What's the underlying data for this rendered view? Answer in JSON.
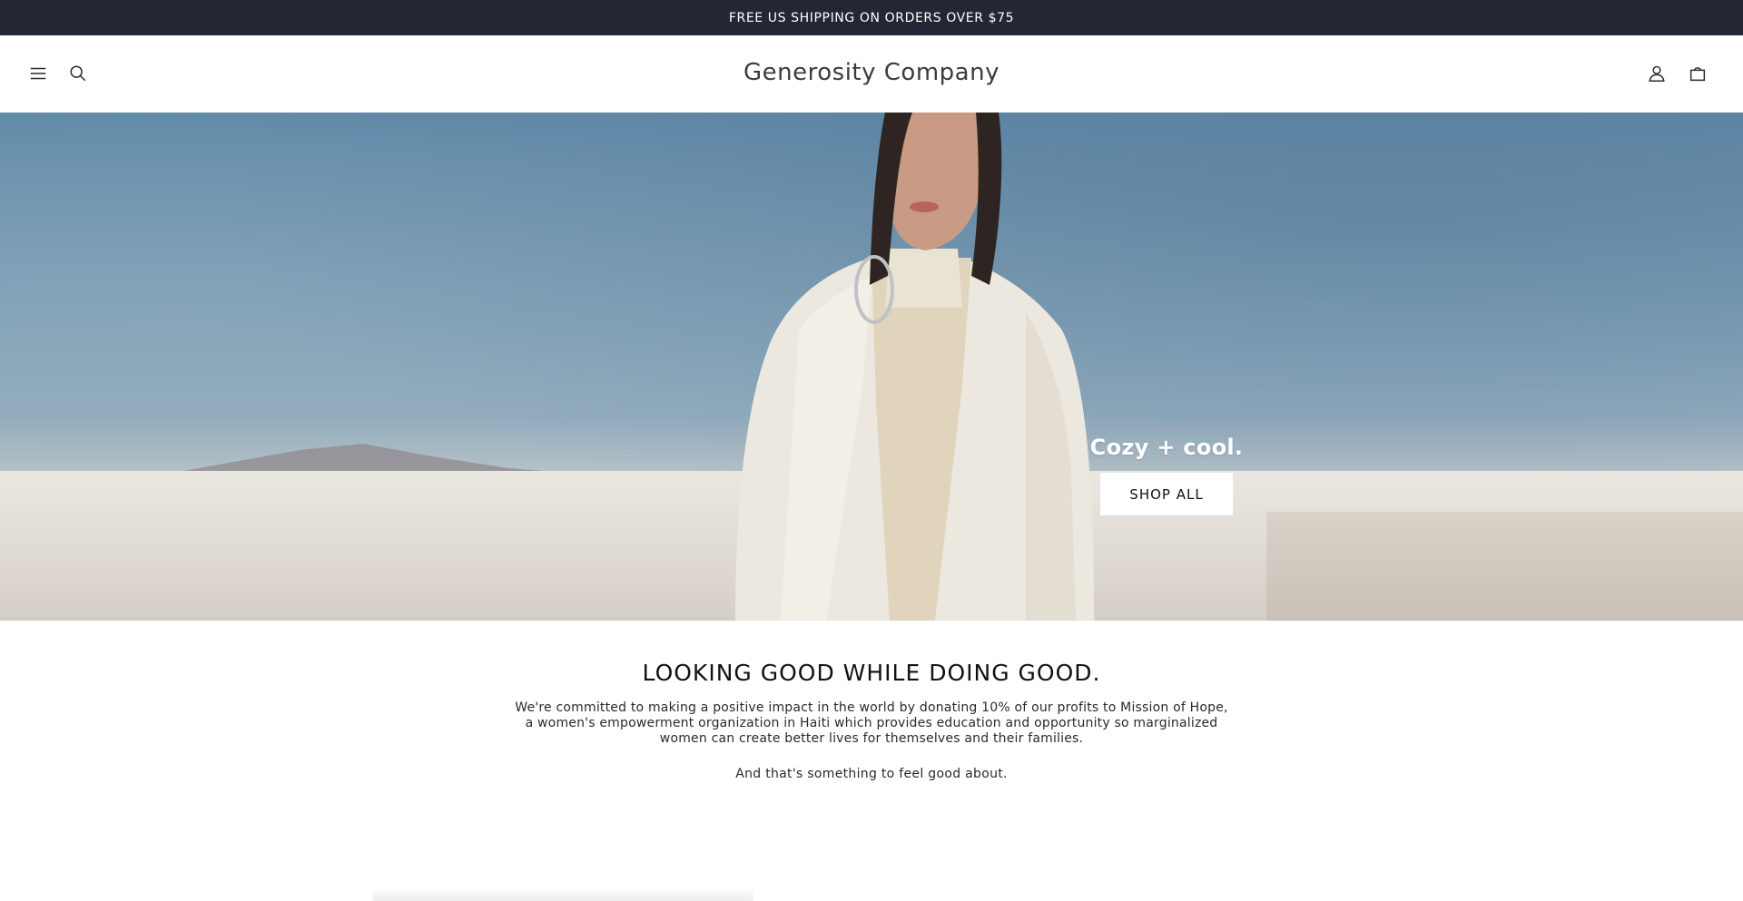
{
  "announcement": {
    "text": "FREE US SHIPPING ON ORDERS OVER $75"
  },
  "header": {
    "logo": "Generosity Company",
    "icons": [
      "menu-icon",
      "search-icon",
      "account-icon",
      "cart-icon"
    ]
  },
  "hero": {
    "heading": "Cozy + cool.",
    "button_label": "SHOP ALL"
  },
  "mission": {
    "title": "LOOKING GOOD WHILE DOING GOOD.",
    "body": "We're committed to making a positive impact in the world by donating 10% of our profits to Mission of Hope, a women's empowerment organization in Haiti which provides education and opportunity so marginalized women can create better lives for themselves and their families.",
    "subtext": "And that's something to feel good about."
  },
  "colors": {
    "announcement_bg": "#232733",
    "text": "#121212",
    "button_bg": "#ffffff"
  }
}
